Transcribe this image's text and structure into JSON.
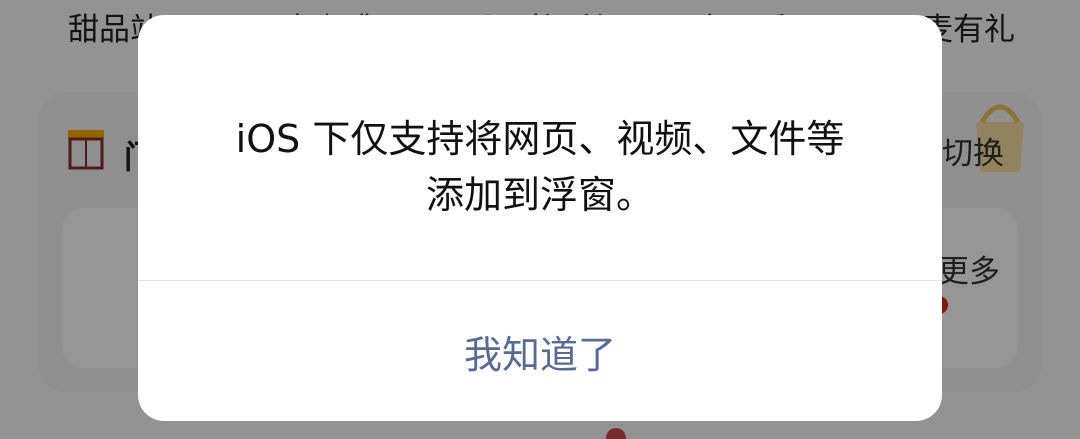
{
  "background": {
    "topnav": {
      "items": [
        "甜品站",
        "麦咖啡",
        "限时福利",
        "亲子乐园",
        "麦有礼"
      ]
    },
    "card": {
      "title_fragment": "门",
      "switch_label": "切换",
      "more_label": "更多"
    }
  },
  "dialog": {
    "message_line1": "iOS 下仅支持将网页、视频、文件等",
    "message_line2": "添加到浮窗。",
    "button_label": "我知道了"
  },
  "colors": {
    "dialog_button_text": "#586b95",
    "overlay": "rgba(0,0,0,0.40)",
    "accent_red": "#e2231a"
  },
  "icons": {
    "store": "store-icon",
    "bag": "shopping-bag-icon"
  }
}
